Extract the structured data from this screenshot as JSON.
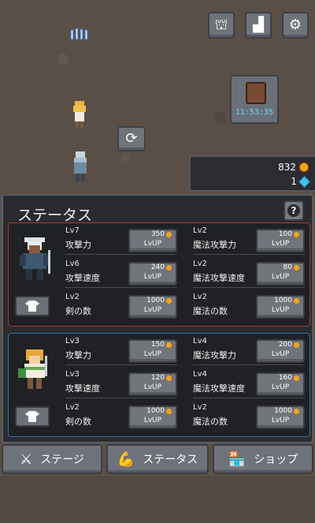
{
  "top_buttons": [
    {
      "name": "tower-button",
      "icon": "tower-icon",
      "glyph": "⛫"
    },
    {
      "name": "podium-button",
      "icon": "podium-icon",
      "glyph": "▟"
    },
    {
      "name": "settings-button",
      "icon": "gear-icon",
      "glyph": "⚙"
    }
  ],
  "pet": {
    "timer": "11:53:35"
  },
  "currency": {
    "coins": "832",
    "gems": "1"
  },
  "panel": {
    "title": "ステータス",
    "help_glyph": "?"
  },
  "characters": [
    {
      "stats": [
        {
          "level": "Lv7",
          "name": "攻撃力",
          "cost": "350",
          "lvup": "LvUP"
        },
        {
          "level": "Lv2",
          "name": "魔法攻撃力",
          "cost": "100",
          "lvup": "LvUP"
        },
        {
          "level": "Lv6",
          "name": "攻撃速度",
          "cost": "240",
          "lvup": "LvUP"
        },
        {
          "level": "Lv2",
          "name": "魔法攻撃速度",
          "cost": "80",
          "lvup": "LvUP"
        },
        {
          "level": "Lv2",
          "name": "剣の数",
          "cost": "1000",
          "lvup": "LvUP"
        },
        {
          "level": "Lv2",
          "name": "魔法の数",
          "cost": "1000",
          "lvup": "LvUP"
        }
      ]
    },
    {
      "stats": [
        {
          "level": "Lv3",
          "name": "攻撃力",
          "cost": "150",
          "lvup": "LvUP"
        },
        {
          "level": "Lv4",
          "name": "魔法攻撃力",
          "cost": "200",
          "lvup": "LvUP"
        },
        {
          "level": "Lv3",
          "name": "攻撃速度",
          "cost": "120",
          "lvup": "LvUP"
        },
        {
          "level": "Lv4",
          "name": "魔法攻撃速度",
          "cost": "160",
          "lvup": "LvUP"
        },
        {
          "level": "Lv2",
          "name": "剣の数",
          "cost": "1000",
          "lvup": "LvUP"
        },
        {
          "level": "Lv2",
          "name": "魔法の数",
          "cost": "1000",
          "lvup": "LvUP"
        }
      ]
    }
  ],
  "nav": [
    {
      "label": "ステージ",
      "icon": "crossed-swords-icon",
      "glyph": "⚔"
    },
    {
      "label": "ステータス",
      "icon": "flexed-arm-icon",
      "glyph": "💪"
    },
    {
      "label": "ショップ",
      "icon": "shop-icon",
      "glyph": "🏪"
    }
  ],
  "colors": {
    "coin": "#f5a21a",
    "gem": "#3ec2f0",
    "card1_border": "#a63a33",
    "card2_border": "#3a6fa8",
    "timer": "#6ad5ff"
  }
}
